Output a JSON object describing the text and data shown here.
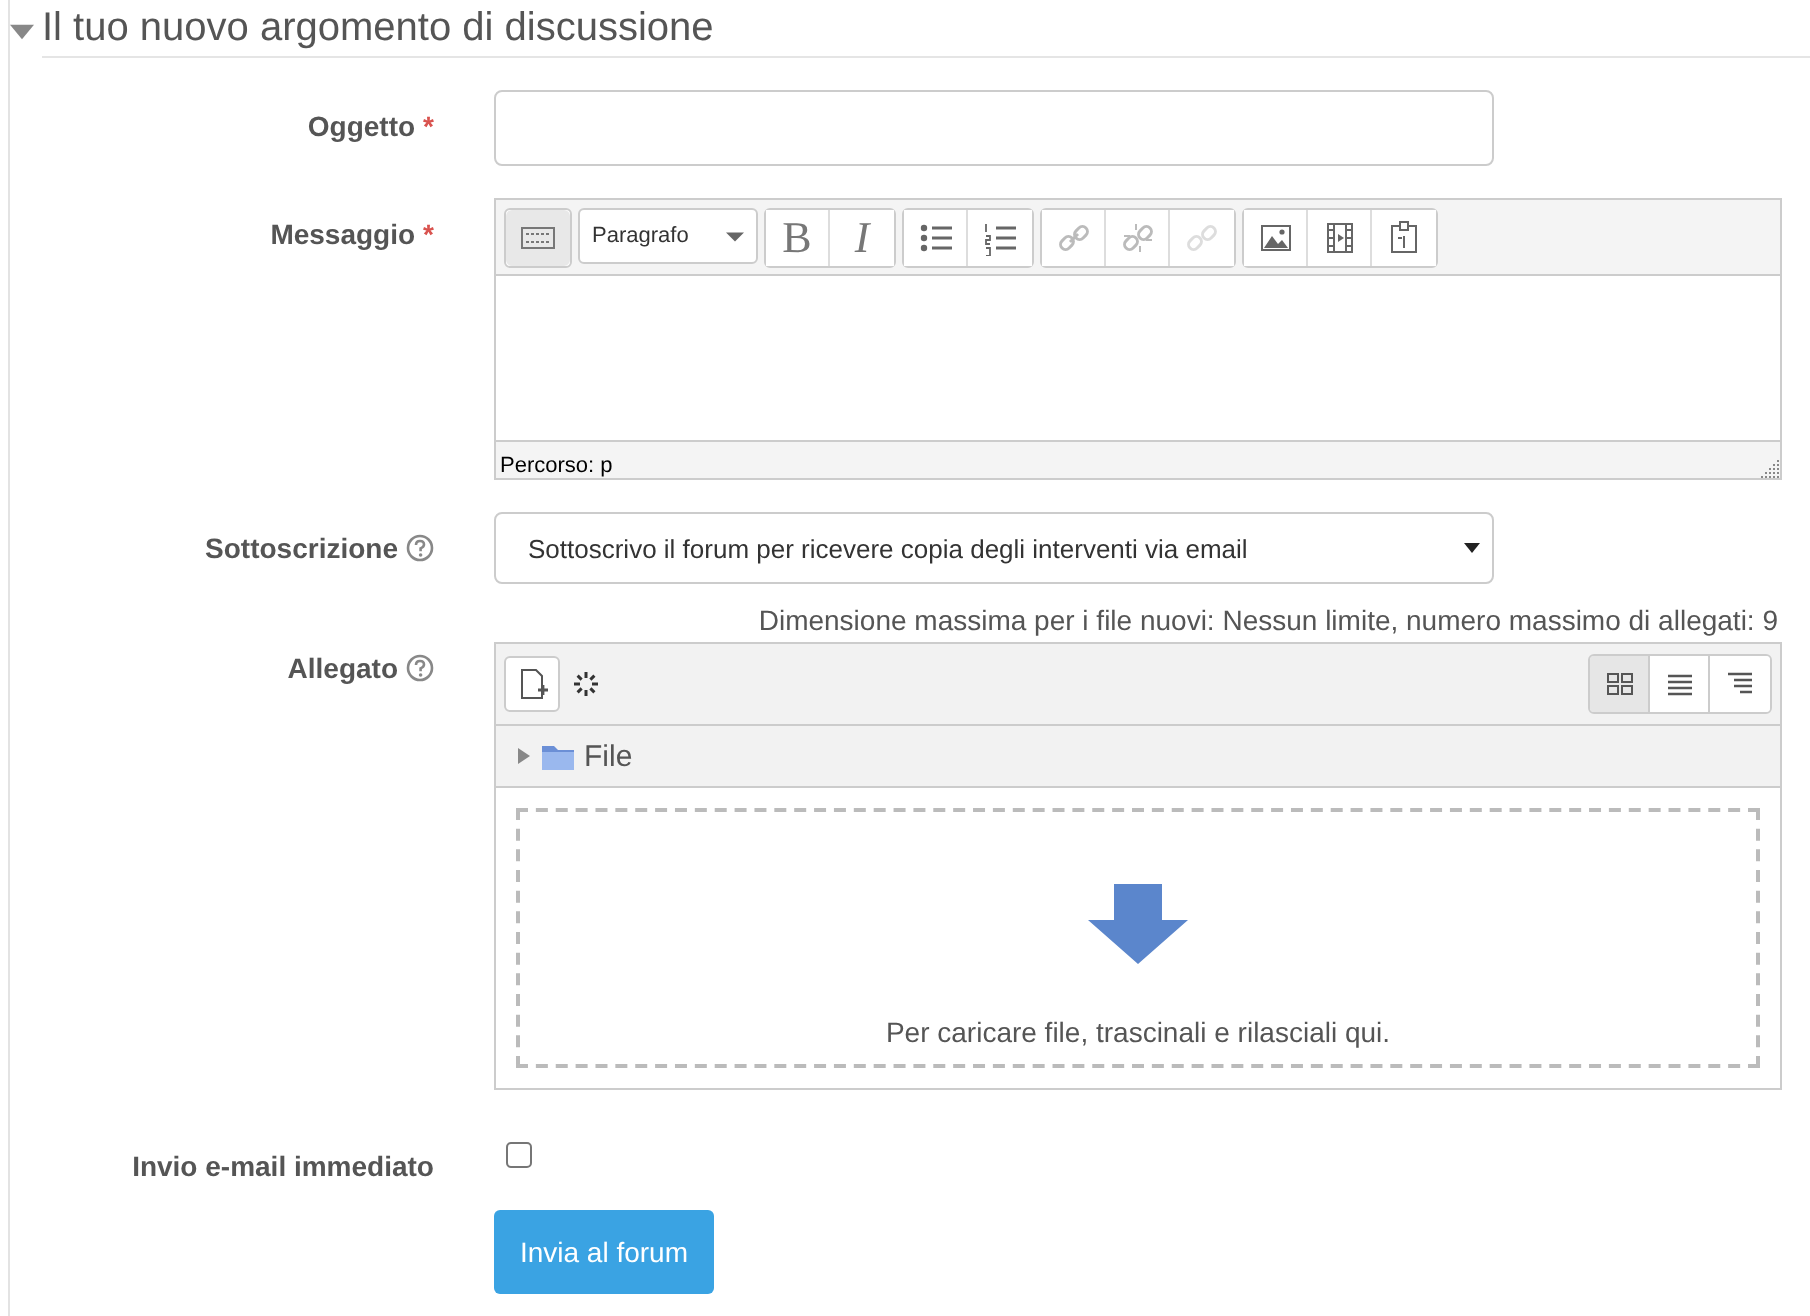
{
  "section": {
    "title": "Il tuo nuovo argomento di discussione",
    "expanded": true
  },
  "fields": [
    {
      "kind": "text",
      "label": "Oggetto",
      "required_mark": "*"
    },
    {
      "kind": "editor",
      "label": "Messaggio",
      "required_mark": "*",
      "format": "Paragrafo",
      "style_glyphs": [
        "B",
        "I"
      ],
      "path": "Percorso: p"
    },
    {
      "kind": "select",
      "label": "Sottoscrizione",
      "help": true,
      "value": "Sottoscrivo il forum per ricevere copia degli interventi via email"
    },
    {
      "kind": "filepicker",
      "label": "Allegato",
      "help": true,
      "limits": "Dimensione massima per i file nuovi: Nessun limite, numero massimo di allegati: 9",
      "views": [
        {
          "selected": true
        },
        {
          "selected": false
        },
        {
          "selected": false
        }
      ],
      "folder": "File",
      "drop_hint": "Per caricare file, trascinali e rilasciali qui."
    },
    {
      "kind": "checkbox",
      "label": "Invio e-mail immediato",
      "checked": false
    }
  ],
  "submit": "Invia al forum"
}
